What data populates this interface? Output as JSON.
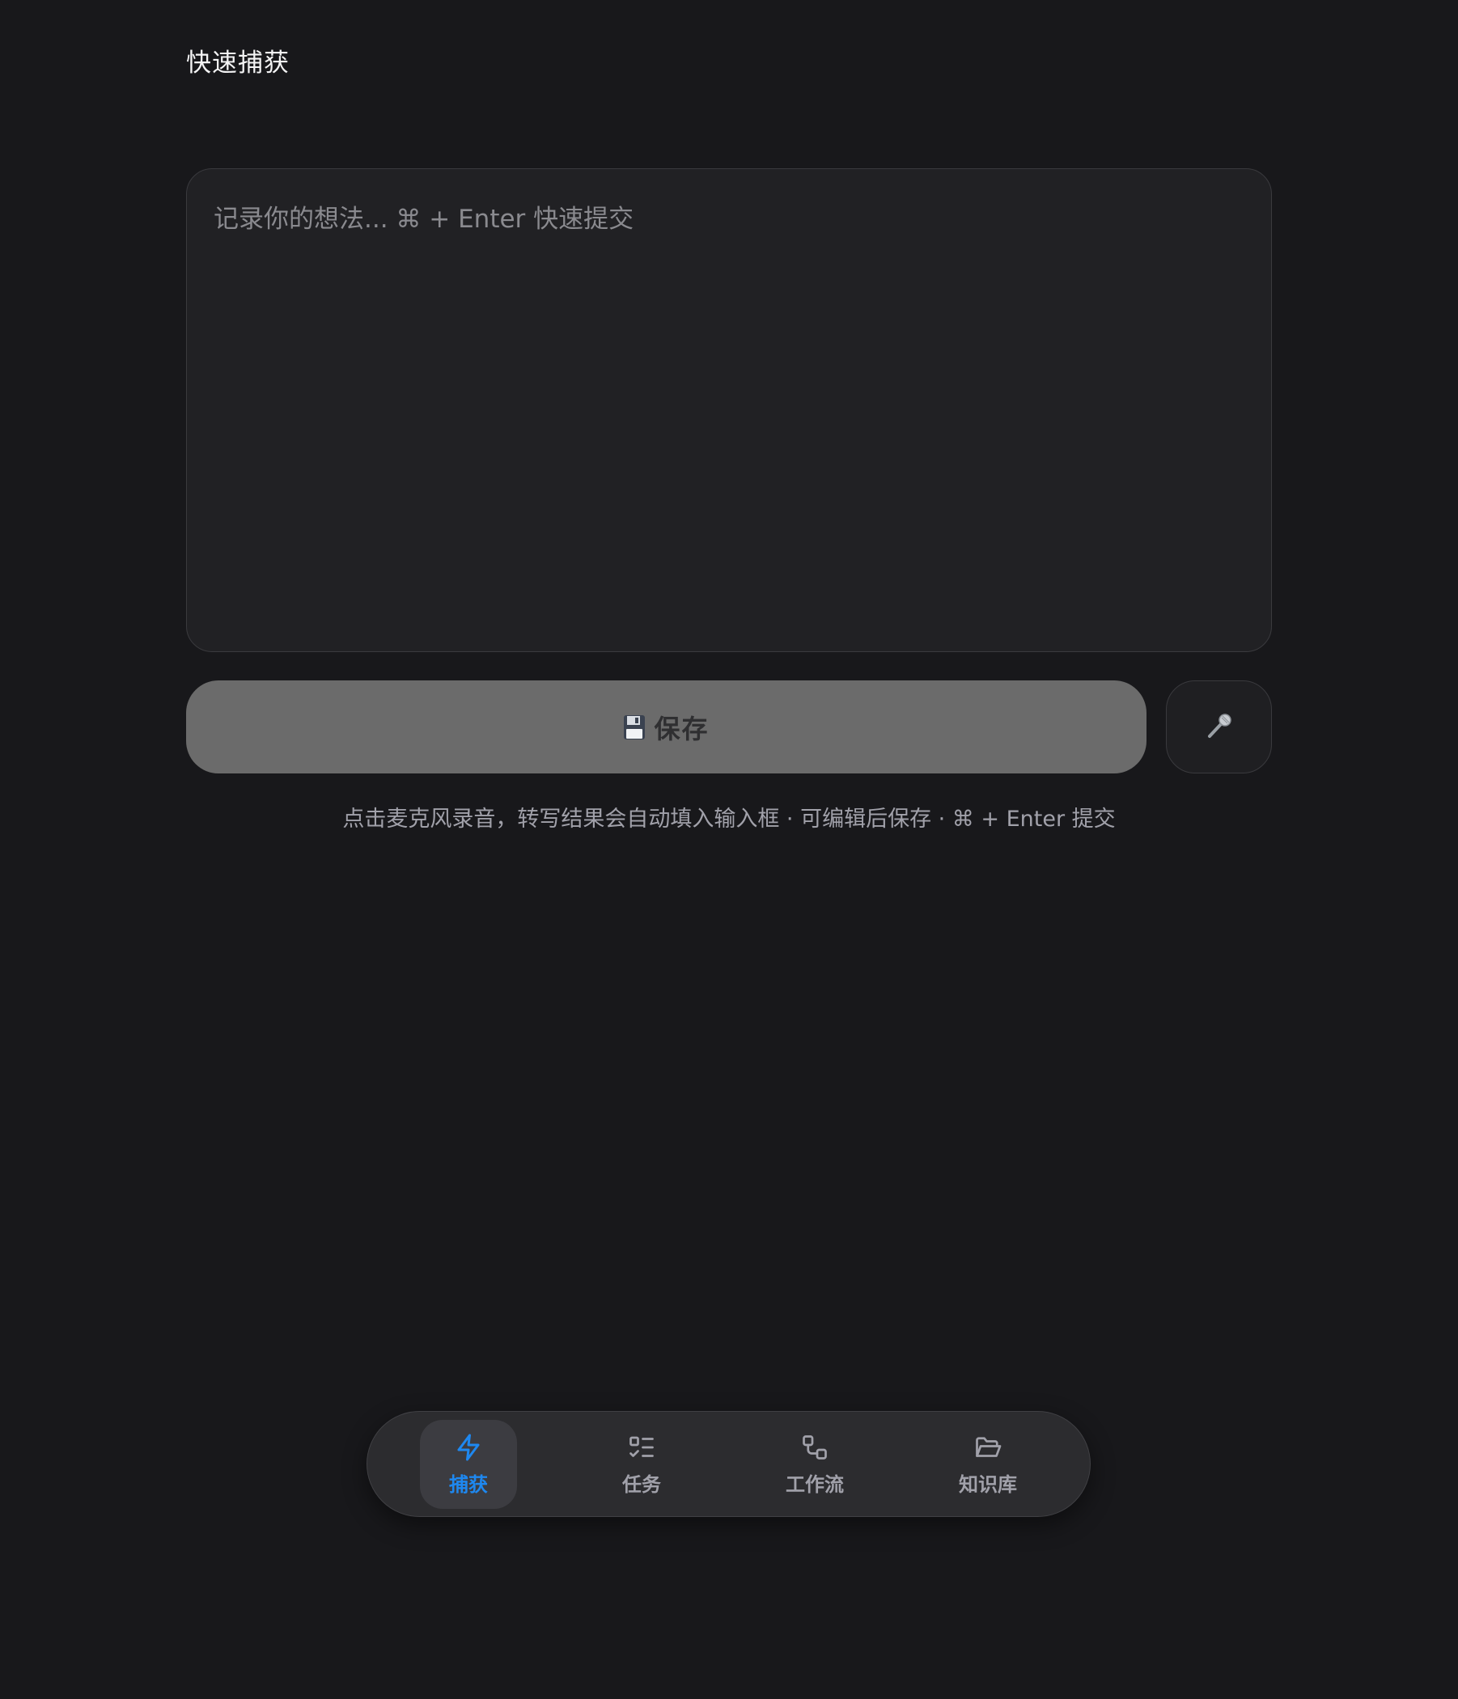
{
  "header": {
    "title": "快速捕获"
  },
  "capture": {
    "placeholder": "记录你的想法... ⌘ + Enter 快速提交",
    "value": ""
  },
  "actions": {
    "save_label": "保存",
    "save_icon": "floppy-disk-icon",
    "mic_icon": "microphone-icon"
  },
  "hint": {
    "text": "点击麦克风录音，转写结果会自动填入输入框 · 可编辑后保存 · ⌘ + Enter 提交"
  },
  "tabbar": {
    "items": [
      {
        "label": "捕获",
        "icon": "lightning-icon",
        "active": true
      },
      {
        "label": "任务",
        "icon": "checklist-icon",
        "active": false
      },
      {
        "label": "工作流",
        "icon": "workflow-icon",
        "active": false
      },
      {
        "label": "知识库",
        "icon": "folder-open-icon",
        "active": false
      }
    ],
    "active_color": "#1e88f0",
    "inactive_color": "#a1a1aa"
  }
}
